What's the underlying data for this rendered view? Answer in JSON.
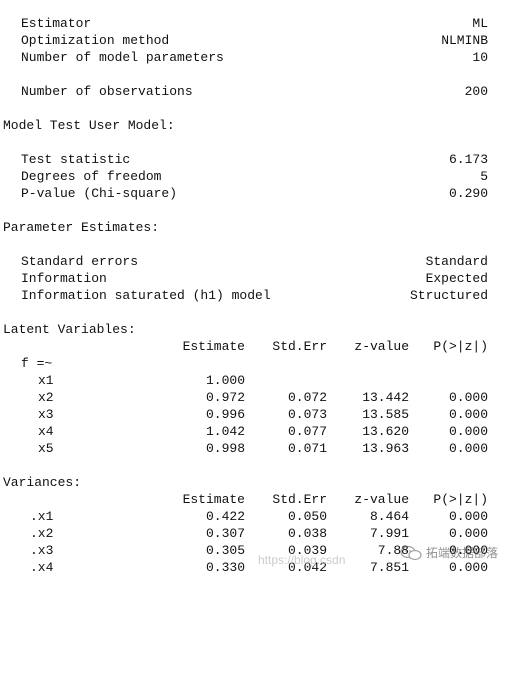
{
  "summary": [
    {
      "label": "Estimator",
      "value": "ML"
    },
    {
      "label": "Optimization method",
      "value": "NLMINB"
    },
    {
      "label": "Number of model parameters",
      "value": "10"
    },
    {
      "label": "Number of observations",
      "value": "200"
    }
  ],
  "model_test": {
    "heading": "Model Test User Model:",
    "rows": [
      {
        "label": "Test statistic",
        "value": "6.173"
      },
      {
        "label": "Degrees of freedom",
        "value": "5"
      },
      {
        "label": "P-value (Chi-square)",
        "value": "0.290"
      }
    ]
  },
  "param_estimates": {
    "heading": "Parameter Estimates:",
    "rows": [
      {
        "label": "Standard errors",
        "value": "Standard"
      },
      {
        "label": "Information",
        "value": "Expected"
      },
      {
        "label": "Information saturated (h1) model",
        "value": "Structured"
      }
    ]
  },
  "columns": [
    "Estimate",
    "Std.Err",
    "z-value",
    "P(>|z|)"
  ],
  "latent": {
    "heading": "Latent Variables:",
    "factor": "f =~",
    "rows": [
      {
        "name": "x1",
        "estimate": "1.000",
        "stderr": "",
        "z": "",
        "p": ""
      },
      {
        "name": "x2",
        "estimate": "0.972",
        "stderr": "0.072",
        "z": "13.442",
        "p": "0.000"
      },
      {
        "name": "x3",
        "estimate": "0.996",
        "stderr": "0.073",
        "z": "13.585",
        "p": "0.000"
      },
      {
        "name": "x4",
        "estimate": "1.042",
        "stderr": "0.077",
        "z": "13.620",
        "p": "0.000"
      },
      {
        "name": "x5",
        "estimate": "0.998",
        "stderr": "0.071",
        "z": "13.963",
        "p": "0.000"
      }
    ]
  },
  "variances": {
    "heading": "Variances:",
    "rows": [
      {
        "name": ".x1",
        "estimate": "0.422",
        "stderr": "0.050",
        "z": "8.464",
        "p": "0.000"
      },
      {
        "name": ".x2",
        "estimate": "0.307",
        "stderr": "0.038",
        "z": "7.991",
        "p": "0.000"
      },
      {
        "name": ".x3",
        "estimate": "0.305",
        "stderr": "0.039",
        "z": "7.88",
        "p": "0.000"
      },
      {
        "name": ".x4",
        "estimate": "0.330",
        "stderr": "0.042",
        "z": "7.851",
        "p": "0.000"
      }
    ]
  },
  "watermark": {
    "url": "https://blog.csdn",
    "text": "拓端数据部落",
    "icon": "wechat-icon"
  }
}
